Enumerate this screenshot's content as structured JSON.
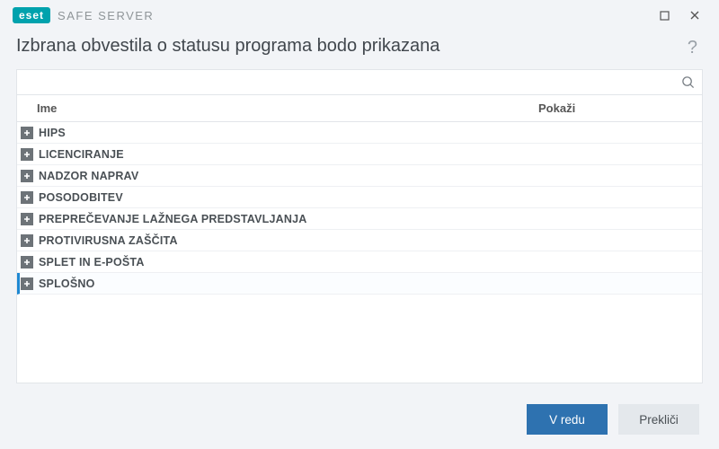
{
  "titlebar": {
    "brand_logo": "eset",
    "product_name": "SAFE SERVER"
  },
  "header": {
    "title": "Izbrana obvestila o statusu programa bodo prikazana",
    "help_tooltip": "?"
  },
  "search": {
    "value": "",
    "placeholder": ""
  },
  "columns": {
    "name": "Ime",
    "show": "Pokaži"
  },
  "tree": {
    "items": [
      {
        "label": "HIPS",
        "selected": false
      },
      {
        "label": "LICENCIRANJE",
        "selected": false
      },
      {
        "label": "NADZOR NAPRAV",
        "selected": false
      },
      {
        "label": "POSODOBITEV",
        "selected": false
      },
      {
        "label": "PREPREČEVANJE LAŽNEGA PREDSTAVLJANJA",
        "selected": false
      },
      {
        "label": "PROTIVIRUSNA ZAŠČITA",
        "selected": false
      },
      {
        "label": "SPLET IN E-POŠTA",
        "selected": false
      },
      {
        "label": "SPLOŠNO",
        "selected": true
      }
    ]
  },
  "buttons": {
    "ok": "V redu",
    "cancel": "Prekliči"
  }
}
